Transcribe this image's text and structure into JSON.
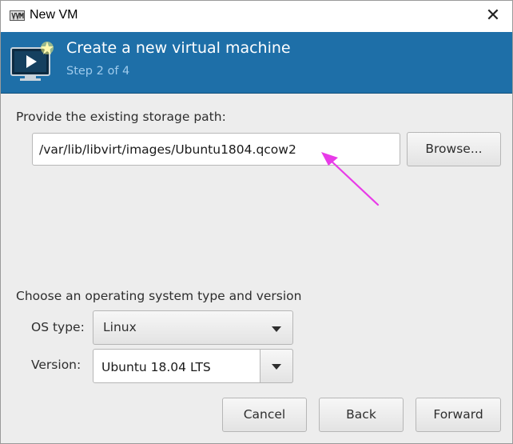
{
  "window": {
    "title": "New VM",
    "icons": {
      "app": "virt-manager-icon",
      "close": "close-icon",
      "header": "vm-console-icon",
      "annotation": "arrow-annotation-icon"
    },
    "close_glyph": "✕"
  },
  "header": {
    "title": "Create a new virtual machine",
    "step": "Step 2 of 4",
    "colors": {
      "background": "#1e6fa8",
      "title": "#ffffff",
      "step": "#9fcbec"
    }
  },
  "storage": {
    "label": "Provide the existing storage path:",
    "path_value": "/var/lib/libvirt/images/Ubuntu1804.qcow2",
    "browse_label": "Browse..."
  },
  "os": {
    "label": "Choose an operating system type and version",
    "type_label": "OS type:",
    "type_value": "Linux",
    "version_label": "Version:",
    "version_value": "Ubuntu 18.04 LTS"
  },
  "buttons": {
    "cancel": "Cancel",
    "back": "Back",
    "forward": "Forward"
  },
  "annotation": {
    "color": "#e83be8"
  }
}
